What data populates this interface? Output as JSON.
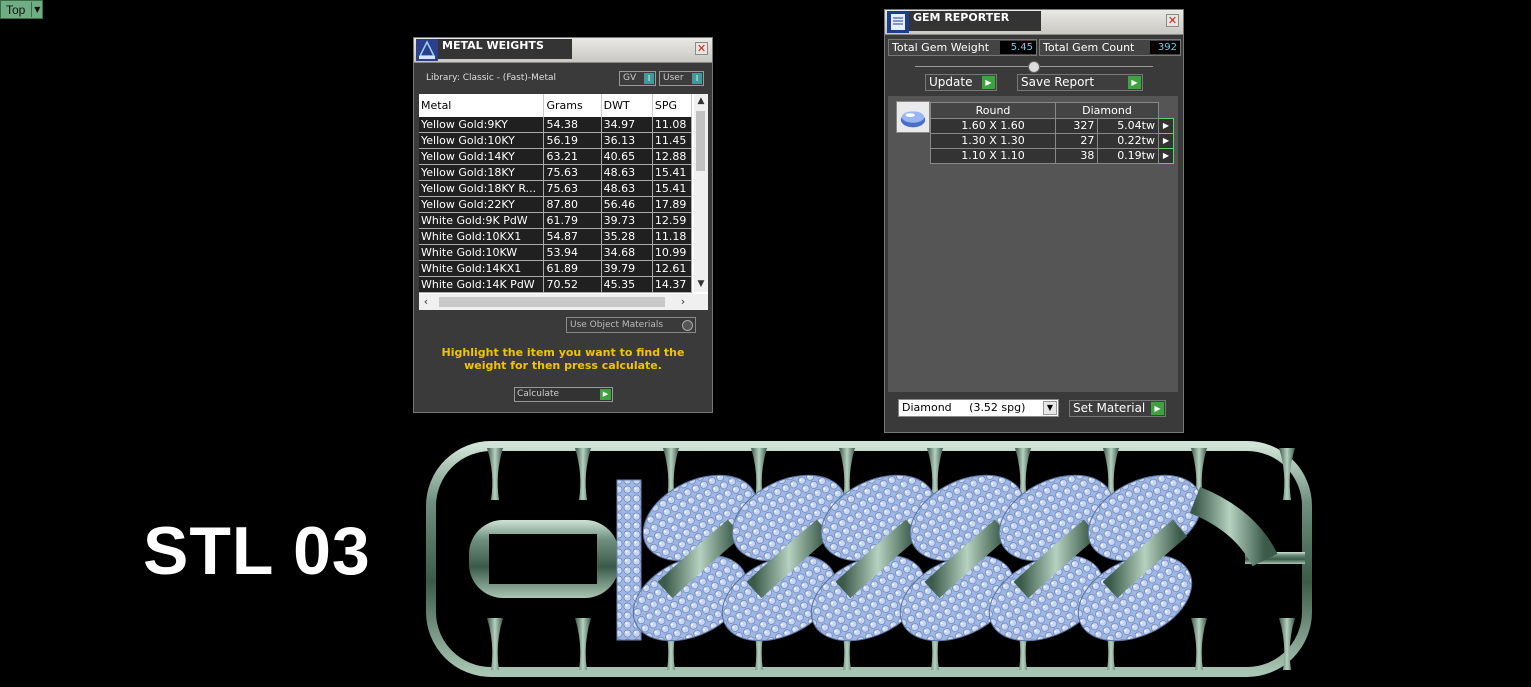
{
  "viewport": {
    "label": "Top"
  },
  "metal_weights": {
    "title": "METAL WEIGHTS",
    "library": "Library: Classic - (Fast)-Metal",
    "gv_label": "GV",
    "user_label": "User",
    "toggle_indicator": "I",
    "columns": [
      "Metal",
      "Grams",
      "DWT",
      "SPG"
    ],
    "rows": [
      [
        "Yellow Gold:9KY",
        "54.38",
        "34.97",
        "11.08"
      ],
      [
        "Yellow Gold:10KY",
        "56.19",
        "36.13",
        "11.45"
      ],
      [
        "Yellow Gold:14KY",
        "63.21",
        "40.65",
        "12.88"
      ],
      [
        "Yellow Gold:18KY",
        "75.63",
        "48.63",
        "15.41"
      ],
      [
        "Yellow Gold:18KY R...",
        "75.63",
        "48.63",
        "15.41"
      ],
      [
        "Yellow Gold:22KY",
        "87.80",
        "56.46",
        "17.89"
      ],
      [
        "White Gold:9K PdW",
        "61.79",
        "39.73",
        "12.59"
      ],
      [
        "White Gold:10KX1",
        "54.87",
        "35.28",
        "11.18"
      ],
      [
        "White Gold:10KW",
        "53.94",
        "34.68",
        "10.99"
      ],
      [
        "White Gold:14KX1",
        "61.89",
        "39.79",
        "12.61"
      ],
      [
        "White Gold:14K PdW",
        "70.52",
        "45.35",
        "14.37"
      ]
    ],
    "use_object_materials": "Use Object Materials",
    "hint": "Highlight the item you want to find the weight for then press calculate.",
    "calculate_label": "Calculate"
  },
  "gem_reporter": {
    "title": "GEM REPORTER",
    "total_weight_label": "Total Gem Weight",
    "total_weight_value": "5.45",
    "total_count_label": "Total Gem Count",
    "total_count_value": "392",
    "update_label": "Update",
    "save_report_label": "Save Report",
    "table_headers": [
      "Round",
      "Diamond"
    ],
    "rows": [
      {
        "size": "1.60 X 1.60",
        "count": "327",
        "weight": "5.04tw"
      },
      {
        "size": "1.30 X 1.30",
        "count": "27",
        "weight": "0.22tw"
      },
      {
        "size": "1.10 X 1.10",
        "count": "38",
        "weight": "0.19tw"
      }
    ],
    "material_select": "Diamond     (3.52 spg)",
    "set_material_label": "Set Material"
  },
  "overlay_text": "STL 03",
  "colors": {
    "accent_green": "#3da43d",
    "metal_green": "#5f7f6e",
    "diamond_blue": "#b5c8ef",
    "hint_yellow": "#f2c400",
    "value_cyan": "#5ed6e6"
  }
}
